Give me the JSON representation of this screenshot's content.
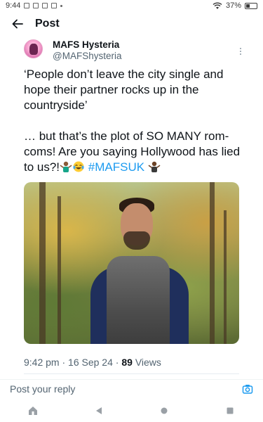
{
  "status_bar": {
    "time": "9:44",
    "battery": "37%",
    "battery_level": 0.37
  },
  "header": {
    "title": "Post"
  },
  "author": {
    "name": "MAFS Hysteria",
    "handle": "@MAFShysteria"
  },
  "tweet": {
    "line1": "‘People don’t leave the city single and hope their partner rocks up in the countryside’",
    "line2": "… but that’s the plot of SO MANY rom-coms! Are you saying Hollywood has lied to us?!",
    "hashtag": "#MAFSUK",
    "emojis": [
      "person-shrugging-icon",
      "face-with-tears-of-joy-icon",
      "man-shrugging-icon"
    ]
  },
  "meta": {
    "time": "9:42 pm",
    "date": "16 Sep 24",
    "views_count": "89",
    "views_label": "Views",
    "sep": " · "
  },
  "reply": {
    "placeholder": "Post your reply"
  },
  "colors": {
    "accent": "#1d9bf0",
    "text": "#0f1419",
    "muted": "#536471"
  }
}
